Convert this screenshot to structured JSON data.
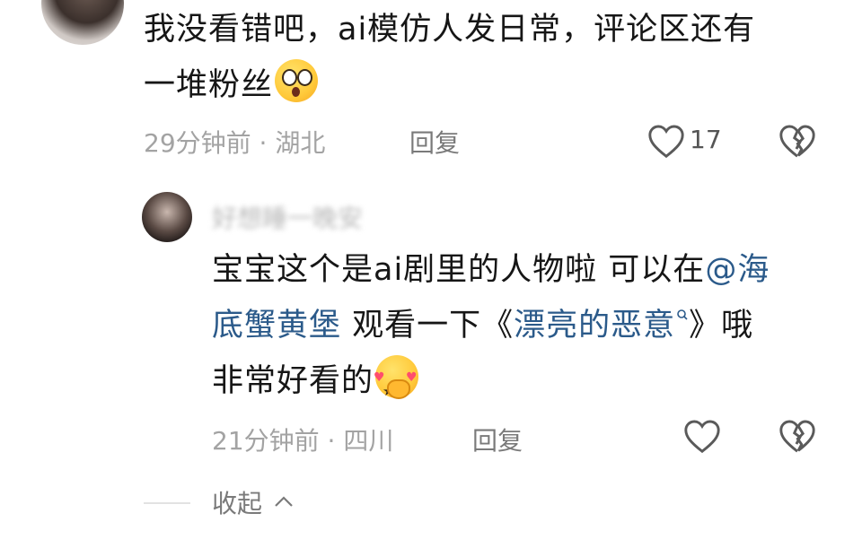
{
  "comment": {
    "line1": "我没看错吧，ai模仿人发日常，评论区还有",
    "line2": "一堆粉丝",
    "time": "29分钟前",
    "location": "湖北",
    "reply_label": "回复",
    "like_count": "17"
  },
  "reply": {
    "username": "好想睡一晚安",
    "line1_a": "宝宝这个是ai剧里的人物啦 可以在",
    "line1_mention": "@海",
    "line2_mention": "底蟹黄堡",
    "line2_b": " 观看一下《",
    "line2_link": "漂亮的恶意",
    "line2_c": "》哦",
    "line3": "非常好看的",
    "time": "21分钟前",
    "location": "四川",
    "reply_label": "回复"
  },
  "collapse_label": "收起",
  "colors": {
    "link": "#2b5a8a",
    "meta": "#a3a3a3",
    "text": "#161616"
  },
  "icons": [
    "heart-outline-icon",
    "broken-heart-icon",
    "search-small-icon",
    "chevron-up-icon"
  ]
}
